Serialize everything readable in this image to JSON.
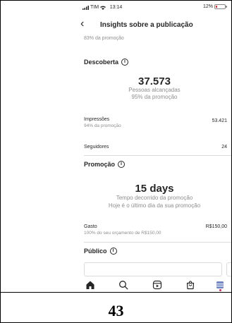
{
  "status_bar": {
    "carrier": "TIM",
    "time": "13:14",
    "battery": "12%"
  },
  "header": {
    "title": "Insights sobre a publicação"
  },
  "previous_row_sub": "83% da promoção",
  "discovery": {
    "title": "Descoberta",
    "reach_value": "37.573",
    "reach_label": "Pessoas alcançadas",
    "reach_sub": "95% da promoção",
    "impressions": {
      "label": "Impressões",
      "sub": "94% da promoção",
      "value": "53.421"
    },
    "followers": {
      "label": "Seguidores",
      "value": "24"
    }
  },
  "promotion": {
    "title": "Promoção",
    "duration_value": "15 days",
    "duration_label": "Tempo decorrido da promoção",
    "duration_sub": "Hoje é o último dia da sua promoção",
    "spend": {
      "label": "Gasto",
      "sub": "100% do seu orçamento de R$150,00",
      "value": "R$150,00"
    }
  },
  "audience": {
    "title": "Público"
  },
  "tabbar": {
    "items": [
      "home-icon",
      "search-icon",
      "reels-icon",
      "shop-icon",
      "profile-icon"
    ],
    "active": "home"
  },
  "page_number": "43"
}
